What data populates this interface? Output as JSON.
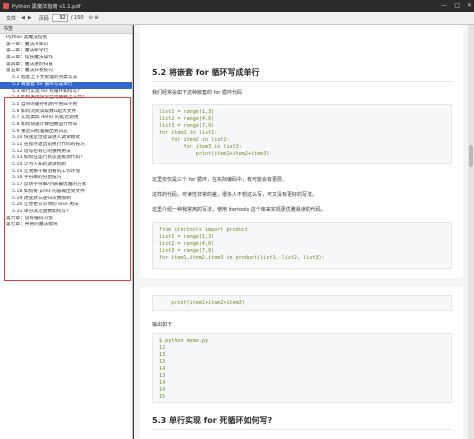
{
  "window": {
    "title": "Python 黑魔法指南 v1.1.pdf",
    "controls": [
      "—",
      "□",
      "✕"
    ]
  },
  "toolbar": {
    "menu_label": "文件",
    "page_label": "页码",
    "page_current": "92",
    "page_total": "/ 150",
    "zoom_label": "⊖ ⊕"
  },
  "sidebar": {
    "header": "书签",
    "items": [
      {
        "label": "Python 黑魔法指南",
        "level": 0
      },
      {
        "label": "第一章：魔法冷知识",
        "level": 1
      },
      {
        "label": "第二章：魔法命令行",
        "level": 1
      },
      {
        "label": "第三章：炫技魔法操作",
        "level": 1
      },
      {
        "label": "第四章：魔法进阶扫盲",
        "level": 1
      },
      {
        "label": "第五章：魔法开发技巧",
        "level": 1
      },
      {
        "label": "5.1 嵌套上下文管理的另类写法",
        "level": 2
      },
      {
        "label": "5.2 将嵌套 for 循环写成单行",
        "level": 2,
        "selected": true
      },
      {
        "label": "5.3 单行实现 for 死循环如何写?",
        "level": 2
      },
      {
        "label": "5.4 如何关闭异常自动关联上下文？",
        "level": 2
      },
      {
        "label": "5.5 自带的缓存机制不用白不用",
        "level": 2
      },
      {
        "label": "5.6 如何流式读取数G超大文件",
        "level": 2
      },
      {
        "label": "5.7 实现类似 defer 的延迟调用",
        "level": 2
      },
      {
        "label": "5.8 如何快速计算函数运行时间",
        "level": 2
      },
      {
        "label": "5.9 重定向标准输出到日志",
        "level": 2
      },
      {
        "label": "5.10 快速定位错误进入调试模式",
        "level": 2
      },
      {
        "label": "5.11 在程序退出前执行代码的技巧",
        "level": 2
      },
      {
        "label": "5.12 逗号也有它的独特用法",
        "level": 2
      },
      {
        "label": "5.13 如何在运行状态查看源代码？",
        "level": 2
      },
      {
        "label": "5.14 少为人知的调试机制",
        "level": 2
      },
      {
        "label": "5.15 让我擦干眼泪看的工作环境",
        "level": 2
      },
      {
        "label": "5.16 字符串的分割技巧",
        "level": 2
      },
      {
        "label": "5.17 反转字符串/列表最优雅的方式",
        "level": 2
      },
      {
        "label": "5.18 如何将 print 内容输出到文件",
        "level": 2
      },
      {
        "label": "5.19 改变默认递归次数限制",
        "level": 2
      },
      {
        "label": "5.20 让你更认识你的 else 用法",
        "level": 2
      },
      {
        "label": "5.21 单分派泛函数如何写？",
        "level": 2
      },
      {
        "label": "第六章：良好编码习惯",
        "level": 1
      },
      {
        "label": "第七章：神奇的魔法模块",
        "level": 1
      }
    ]
  },
  "content": {
    "heading_52": "5.2 将嵌套 for 循环写成单行",
    "p1": "我们经常会如下这种嵌套的 for 循环代码",
    "code1": [
      "list1 = range(1,3)",
      "list2 = range(4,6)",
      "list3 = range(7,9)",
      "for item1 in list1:",
      "    for item2 in list2:",
      "        for item3 in list3:",
      "            print(item1+item2+item3)"
    ],
    "p2": "这里仅仅是三个 for 循环，在实际编码中，有可能会有更层。",
    "p3": "这样的代码，可读性非常的差，很多人不想这么写，可又没有更好的写法。",
    "p4": "这里介绍一种我常用的写法，使用 itertools 这个库来实现更优雅易读的代码。",
    "code2": [
      "from itertools import product",
      "list1 = range(1,3)",
      "list2 = range(4,6)",
      "list3 = range(7,9)",
      "for item1,item2,item3 in product(list1, list2, list3):"
    ],
    "code3": [
      "    print(item1+item2+item3)"
    ],
    "p5": "输出如下",
    "code4": [
      "$ python demo.py",
      "12",
      "13",
      "13",
      "14",
      "13",
      "14",
      "14",
      "15"
    ],
    "heading_53": "5.3 单行实现 for 死循环如何写?"
  },
  "colors": {
    "selected": "#3366cc",
    "highlight_border": "#e23c3c",
    "code_string": "#6b8e23",
    "code_keyword": "#1f6fb2"
  }
}
